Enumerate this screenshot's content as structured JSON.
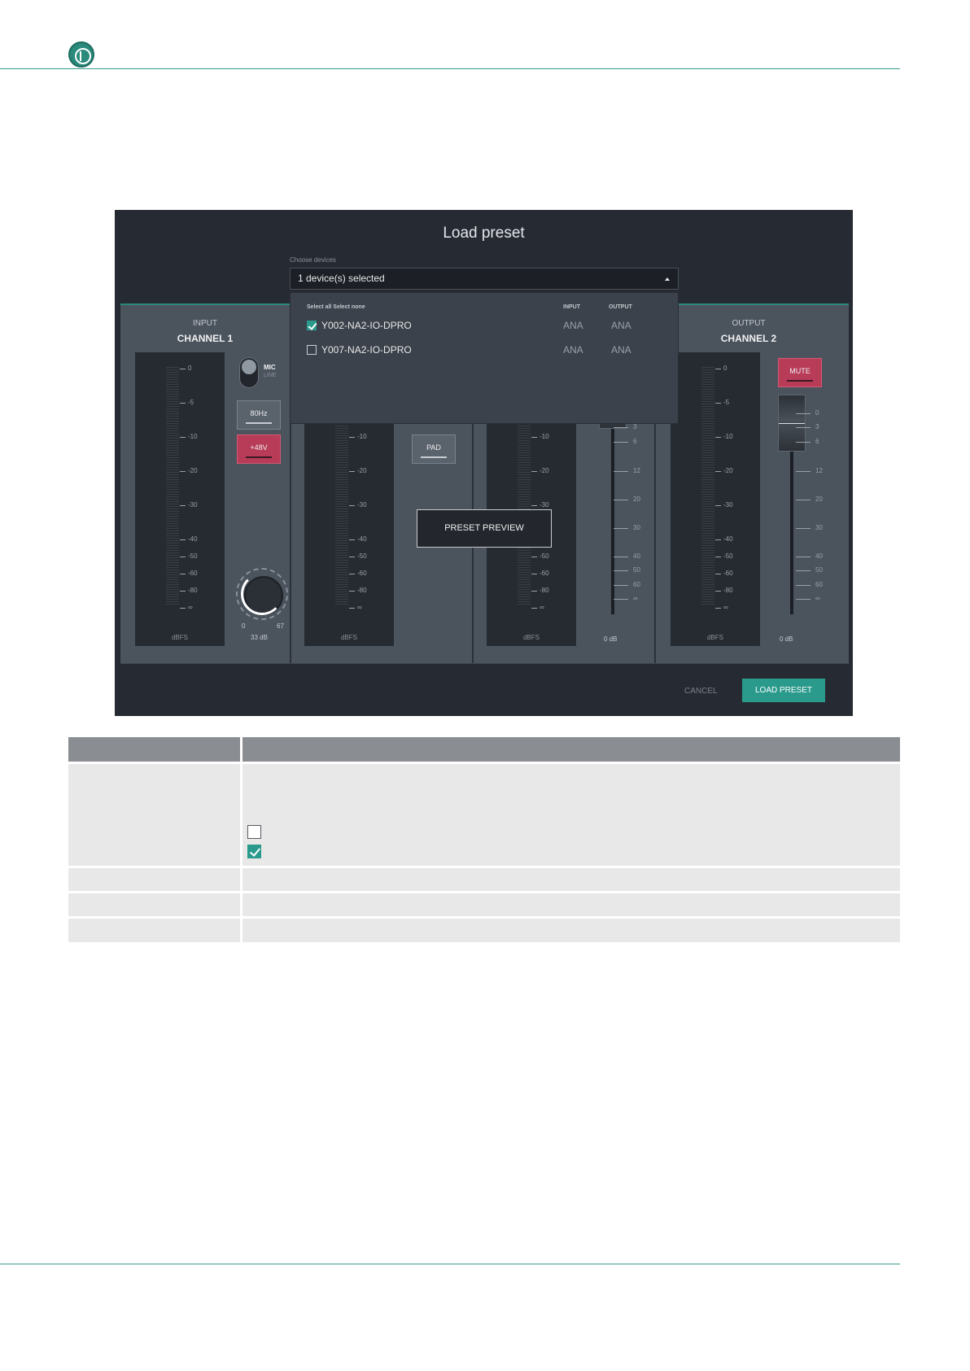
{
  "dialog": {
    "title": "Load preset",
    "choose_label": "Choose devices",
    "selected_text": "1 device(s) selected",
    "preview_label": "PRESET PREVIEW",
    "cancel_label": "CANCEL",
    "load_label": "LOAD PRESET"
  },
  "dropdown": {
    "select_links": "Select all  Select none",
    "col_input": "INPUT",
    "col_output": "OUTPUT",
    "devices": [
      {
        "name": "Y002-NA2-IO-DPRO",
        "checked": true,
        "input": "ANA",
        "output": "ANA"
      },
      {
        "name": "Y007-NA2-IO-DPRO",
        "checked": false,
        "input": "ANA",
        "output": "ANA"
      }
    ]
  },
  "mixer": {
    "input_sub": "INPUT",
    "input_main": "CHANNEL 1",
    "output_sub": "OUTPUT",
    "output_main": "CHANNEL 2",
    "meter_ticks": [
      "0",
      "-5",
      "-10",
      "-20",
      "-30",
      "-40",
      "-50",
      "-60",
      "-80",
      "∞"
    ],
    "meter_ticks_partial": [
      "-10",
      "-20",
      "-30",
      "-40",
      "-50",
      "-60",
      "-80",
      "∞"
    ],
    "meter_unit": "dBFS",
    "mic_label": "MIC",
    "line_label": "LINE",
    "hpf_label": "80Hz",
    "phantom_label": "+48V",
    "pad_label": "PAD",
    "mute_label": "MUTE",
    "knob_min": "0",
    "knob_max": "67",
    "gain_value": "33 dB",
    "fader_value": "0 dB",
    "fader_scale": [
      "0",
      "3",
      "6",
      "12",
      "20",
      "30",
      "40",
      "50",
      "60",
      "∞"
    ],
    "fader_scale_partial": [
      "3",
      "6",
      "12",
      "20",
      "30",
      "40",
      "50",
      "60",
      "∞"
    ]
  },
  "colors": {
    "accent": "#2a9a8c",
    "mute": "#b83b58",
    "dialog_bg": "#262b33"
  }
}
